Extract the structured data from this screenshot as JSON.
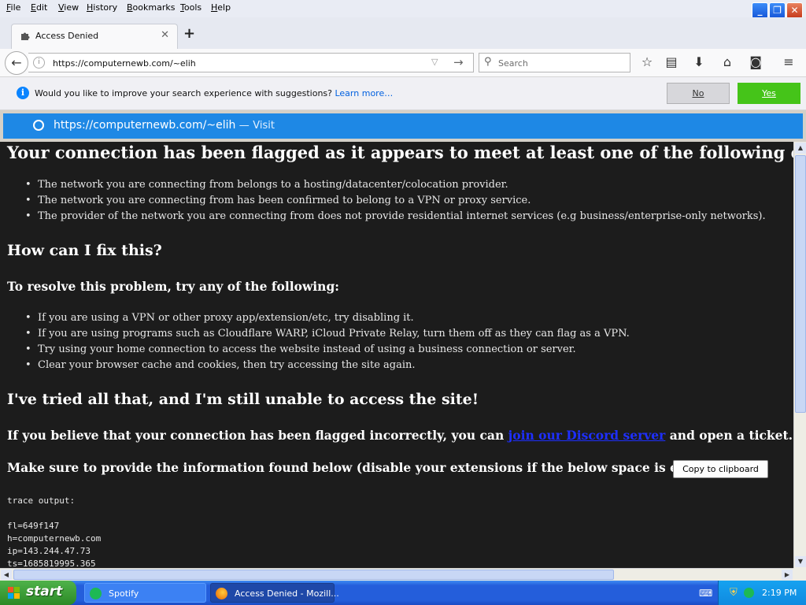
{
  "menubar": {
    "items": [
      "File",
      "Edit",
      "View",
      "History",
      "Bookmarks",
      "Tools",
      "Help"
    ]
  },
  "tab": {
    "title": "Access Denied"
  },
  "navbar": {
    "url": "https://computernewb.com/~elih",
    "search_placeholder": "Search"
  },
  "suggestion_bar": {
    "message": "Would you like to improve your search experience with suggestions?",
    "learn_more": "Learn more…",
    "no_label": "No",
    "yes_label": "Yes"
  },
  "autocomplete": {
    "url": "https://computernewb.com/~elih",
    "separator": "—",
    "action": "Visit"
  },
  "page": {
    "heading_flagged": "Your connection has been flagged as it appears to meet at least one of the following criteria:",
    "criteria": [
      "The network you are connecting from belongs to a hosting/datacenter/colocation provider.",
      "The network you are connecting from has been confirmed to belong to a VPN or proxy service.",
      "The provider of the network you are connecting from does not provide residential internet services (e.g business/enterprise-only networks)."
    ],
    "heading_fix": "How can I fix this?",
    "subheading_resolve": "To resolve this problem, try any of the following:",
    "fixes": [
      "If you are using a VPN or other proxy app/extension/etc, try disabling it.",
      "If you are using programs such as Cloudflare WARP, iCloud Private Relay, turn them off as they can flag as a VPN.",
      "Try using your home connection to access the website instead of using a business connection or server.",
      "Clear your browser cache and cookies, then try accessing the site again."
    ],
    "heading_tried": "I've tried all that, and I'm still unable to access the site!",
    "flagged_prefix": "If you believe that your connection has been flagged incorrectly, you can",
    "discord_link": "join our Discord server",
    "flagged_suffix": "and open a ticket.",
    "provide_info": "Make sure to provide the information found below (disable your extensions if the below space is empty):",
    "copy_button": "Copy to clipboard",
    "trace_label": "trace output:",
    "trace_lines": [
      "fl=649f147",
      "h=computernewb.com",
      "ip=143.244.47.73",
      "ts=1685819995.365"
    ]
  },
  "taskbar": {
    "start_label": "start",
    "tasks": [
      "Spotify",
      "Access Denied - Mozill..."
    ],
    "clock": "2:19 PM"
  },
  "colors": {
    "page_background": "#1c1c1c",
    "autocomplete_highlight": "#1e88e5",
    "yes_button": "#45c419",
    "link": "#1e2fff"
  }
}
